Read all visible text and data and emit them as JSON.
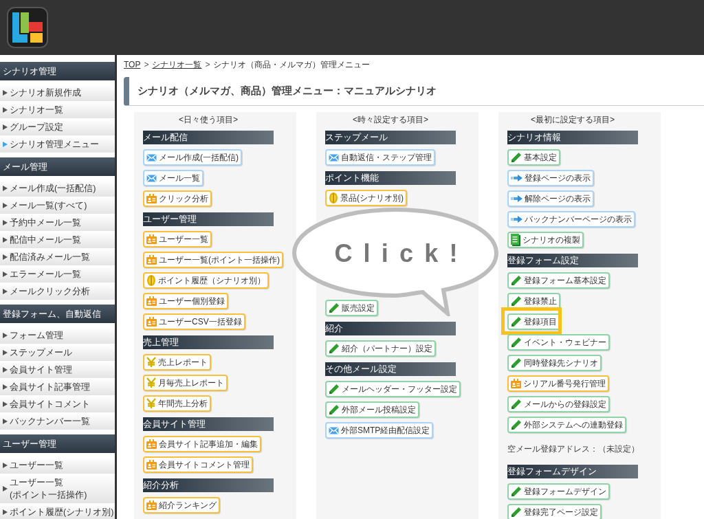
{
  "sidebar": [
    {
      "heading": "シナリオ管理",
      "items": [
        {
          "label": "シナリオ新規作成",
          "selected": false
        },
        {
          "label": "シナリオ一覧",
          "selected": false
        },
        {
          "label": "グループ設定",
          "selected": false
        },
        {
          "label": "シナリオ管理メニュー",
          "selected": true
        }
      ]
    },
    {
      "heading": "メール管理",
      "items": [
        {
          "label": "メール作成(一括配信)",
          "selected": false
        },
        {
          "label": "メール一覧(すべて)",
          "selected": false
        },
        {
          "label": "予約中メール一覧",
          "selected": false
        },
        {
          "label": "配信中メール一覧",
          "selected": false
        },
        {
          "label": "配信済みメール一覧",
          "selected": false
        },
        {
          "label": "エラーメール一覧",
          "selected": false
        },
        {
          "label": "メールクリック分析",
          "selected": false
        }
      ]
    },
    {
      "heading": "登録フォーム、自動返信",
      "items": [
        {
          "label": "フォーム管理",
          "selected": false
        },
        {
          "label": "ステップメール",
          "selected": false
        },
        {
          "label": "会員サイト管理",
          "selected": false
        },
        {
          "label": "会員サイト記事管理",
          "selected": false
        },
        {
          "label": "会員サイトコメント",
          "selected": false
        },
        {
          "label": "バックナンバー一覧",
          "selected": false
        }
      ]
    },
    {
      "heading": "ユーザー管理",
      "items": [
        {
          "label": "ユーザー一覧",
          "selected": false
        },
        {
          "label": "ユーザー一覧\n(ポイント一括操作)",
          "selected": false
        },
        {
          "label": "ポイント履歴(シナリオ別)",
          "selected": false
        }
      ]
    }
  ],
  "breadcrumb_separator": ">",
  "breadcrumb": [
    {
      "label": "TOP",
      "link": true
    },
    {
      "label": "シナリオ一覧",
      "link": true
    },
    {
      "label": "シナリオ（商品・メルマガ）管理メニュー",
      "link": false
    }
  ],
  "page_title": "シナリオ（メルマガ、商品）管理メニュー：マニュアルシナリオ",
  "columns": [
    {
      "title": "<日々使う項目>",
      "groups": [
        {
          "heading": "メール配信",
          "items": [
            {
              "kind": "mail",
              "label": "メール作成(一括配信)"
            },
            {
              "kind": "mail",
              "label": "メール一覧"
            },
            {
              "kind": "user",
              "label": "クリック分析"
            }
          ]
        },
        {
          "heading": "ユーザー管理",
          "items": [
            {
              "kind": "user",
              "label": "ユーザー一覧"
            },
            {
              "kind": "user",
              "label": "ユーザー一覧(ポイント一括操作)"
            },
            {
              "kind": "point",
              "label": "ポイント履歴（シナリオ別）"
            },
            {
              "kind": "user",
              "label": "ユーザー個別登録"
            },
            {
              "kind": "user",
              "label": "ユーザーCSV一括登録"
            }
          ]
        },
        {
          "heading": "売上管理",
          "items": [
            {
              "kind": "yen",
              "label": "売上レポート"
            },
            {
              "kind": "yen",
              "label": "月毎売上レポート"
            },
            {
              "kind": "yen",
              "label": "年間売上分析"
            }
          ]
        },
        {
          "heading": "会員サイト管理",
          "items": [
            {
              "kind": "user",
              "label": "会員サイト記事追加・編集"
            },
            {
              "kind": "user",
              "label": "会員サイトコメント管理"
            }
          ]
        },
        {
          "heading": "紹介分析",
          "items": [
            {
              "kind": "user",
              "label": "紹介ランキング"
            }
          ]
        }
      ]
    },
    {
      "title": "<時々設定する項目>",
      "groups": [
        {
          "heading": "ステップメール",
          "items": [
            {
              "kind": "mail",
              "label": "自動返信・ステップ管理"
            }
          ]
        },
        {
          "heading": "ポイント機能",
          "items": [
            {
              "kind": "point",
              "label": "景品(シナリオ別)"
            }
          ]
        },
        {
          "items": [
            {
              "kind": "edit",
              "label": "販売設定"
            }
          ]
        },
        {
          "heading": "紹介",
          "items": [
            {
              "kind": "edit",
              "label": "紹介（パートナー）設定"
            }
          ]
        },
        {
          "heading": "その他メール設定",
          "items": [
            {
              "kind": "edit",
              "label": "メールヘッダー・フッター設定"
            },
            {
              "kind": "edit",
              "label": "外部メール投稿設定"
            },
            {
              "kind": "mail",
              "label": "外部SMTP経由配信設定"
            }
          ]
        }
      ]
    },
    {
      "title": "<最初に設定する項目>",
      "groups": [
        {
          "heading": "シナリオ情報",
          "items": [
            {
              "kind": "edit",
              "label": "基本設定"
            },
            {
              "kind": "arrow",
              "label": "登録ページの表示"
            },
            {
              "kind": "arrow",
              "label": "解除ページの表示"
            },
            {
              "kind": "arrow",
              "label": "バックナンバーページの表示"
            },
            {
              "kind": "copy",
              "label": "シナリオの複製"
            }
          ]
        },
        {
          "heading": "登録フォーム設定",
          "items": [
            {
              "kind": "edit",
              "label": "登録フォーム基本設定"
            },
            {
              "kind": "edit",
              "label": "登録禁止"
            },
            {
              "kind": "edit",
              "label": "登録項目",
              "highlighted": true
            },
            {
              "kind": "edit",
              "label": "イベント・ウェビナー"
            },
            {
              "kind": "edit",
              "label": "同時登録先シナリオ"
            },
            {
              "kind": "user",
              "label": "シリアル番号発行管理"
            },
            {
              "kind": "edit",
              "label": "メールからの登録設定"
            },
            {
              "kind": "edit",
              "label": "外部システムへの連動登録"
            },
            {
              "kind": "note",
              "label": "空メール登録アドレス：（未設定）"
            }
          ]
        },
        {
          "heading": "登録フォームデザイン",
          "items": [
            {
              "kind": "edit",
              "label": "登録フォームデザイン"
            },
            {
              "kind": "edit",
              "label": "登録完了ページ設定"
            }
          ]
        }
      ]
    }
  ],
  "callout": {
    "text": "Click!"
  }
}
